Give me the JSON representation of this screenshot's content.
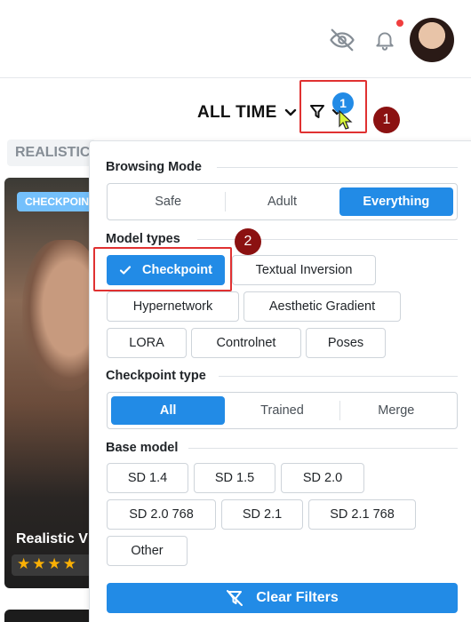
{
  "sort": {
    "label": "ALL TIME"
  },
  "filter": {
    "active_count": "1"
  },
  "annotations": {
    "step1": "1",
    "step2": "2"
  },
  "background": {
    "tag": "REALISTIC",
    "card_badge": "CHECKPOINT",
    "card_title": "Realistic V",
    "card_stars": "★★★★"
  },
  "browsing_mode": {
    "title": "Browsing Mode",
    "options": [
      "Safe",
      "Adult",
      "Everything"
    ],
    "selected": "Everything"
  },
  "model_types": {
    "title": "Model types",
    "options": [
      "Checkpoint",
      "Textual Inversion",
      "Hypernetwork",
      "Aesthetic Gradient",
      "LORA",
      "Controlnet",
      "Poses"
    ],
    "selected": [
      "Checkpoint"
    ]
  },
  "checkpoint_type": {
    "title": "Checkpoint type",
    "options": [
      "All",
      "Trained",
      "Merge"
    ],
    "selected": "All"
  },
  "base_model": {
    "title": "Base model",
    "options": [
      "SD 1.4",
      "SD 1.5",
      "SD 2.0",
      "SD 2.0 768",
      "SD 2.1",
      "SD 2.1 768",
      "Other"
    ]
  },
  "clear_filters": {
    "label": "Clear Filters"
  },
  "colors": {
    "accent": "#228be6",
    "annotation": "#e03131",
    "annotation_badge": "#8b1111",
    "notification_dot": "#f03e3e"
  },
  "icons": [
    "eye-off-icon",
    "bell-icon",
    "chevron-down-icon",
    "filter-icon",
    "check-icon",
    "filter-off-icon"
  ]
}
